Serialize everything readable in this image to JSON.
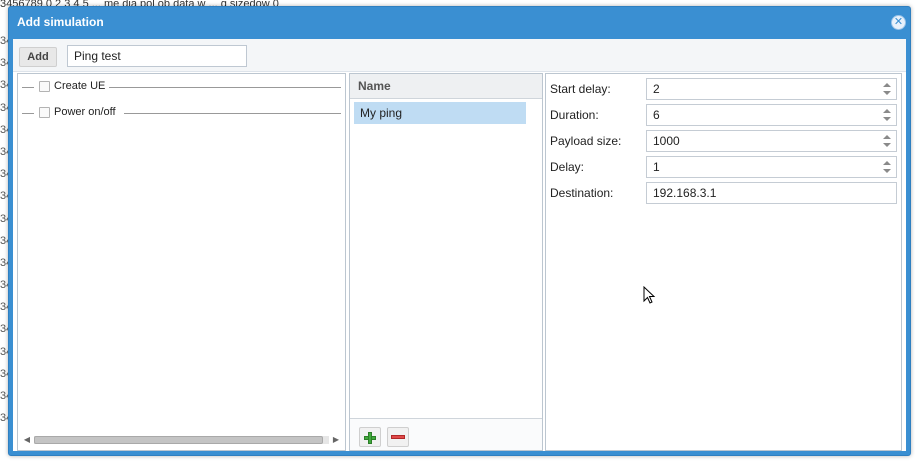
{
  "background": {
    "top_text": "3456789      0             2   3   4   5 ...   me    dia     pol   ob  data   w ... g  sizedow  0",
    "gutter": [
      "34",
      "34",
      "34",
      "34",
      "34",
      "34",
      "34",
      "34",
      "34",
      "34",
      "34",
      "34",
      "34",
      "34",
      "34",
      "34",
      "34",
      "34"
    ]
  },
  "dialog": {
    "title": "Add simulation",
    "close_icon": "close-icon"
  },
  "toolbar": {
    "add_label": "Add",
    "name_value": "Ping test"
  },
  "tree": {
    "items": [
      {
        "label": "Create UE",
        "checked": false
      },
      {
        "label": "Power on/off",
        "checked": false
      }
    ]
  },
  "list": {
    "header": "Name",
    "rows": [
      {
        "label": "My ping",
        "selected": true
      }
    ],
    "add_icon": "plus-icon",
    "remove_icon": "minus-icon"
  },
  "properties": {
    "rows": [
      {
        "label": "Start delay:",
        "value": "2",
        "spinner": true
      },
      {
        "label": "Duration:",
        "value": "6",
        "spinner": true
      },
      {
        "label": "Payload size:",
        "value": "1000",
        "spinner": true
      },
      {
        "label": "Delay:",
        "value": "1",
        "spinner": true
      },
      {
        "label": "Destination:",
        "value": "192.168.3.1",
        "spinner": false
      }
    ]
  },
  "colors": {
    "title_bar": "#3a8fd2",
    "selection": "#bfdcf3",
    "add_green": "#3fa93b",
    "remove_red": "#e04848"
  }
}
